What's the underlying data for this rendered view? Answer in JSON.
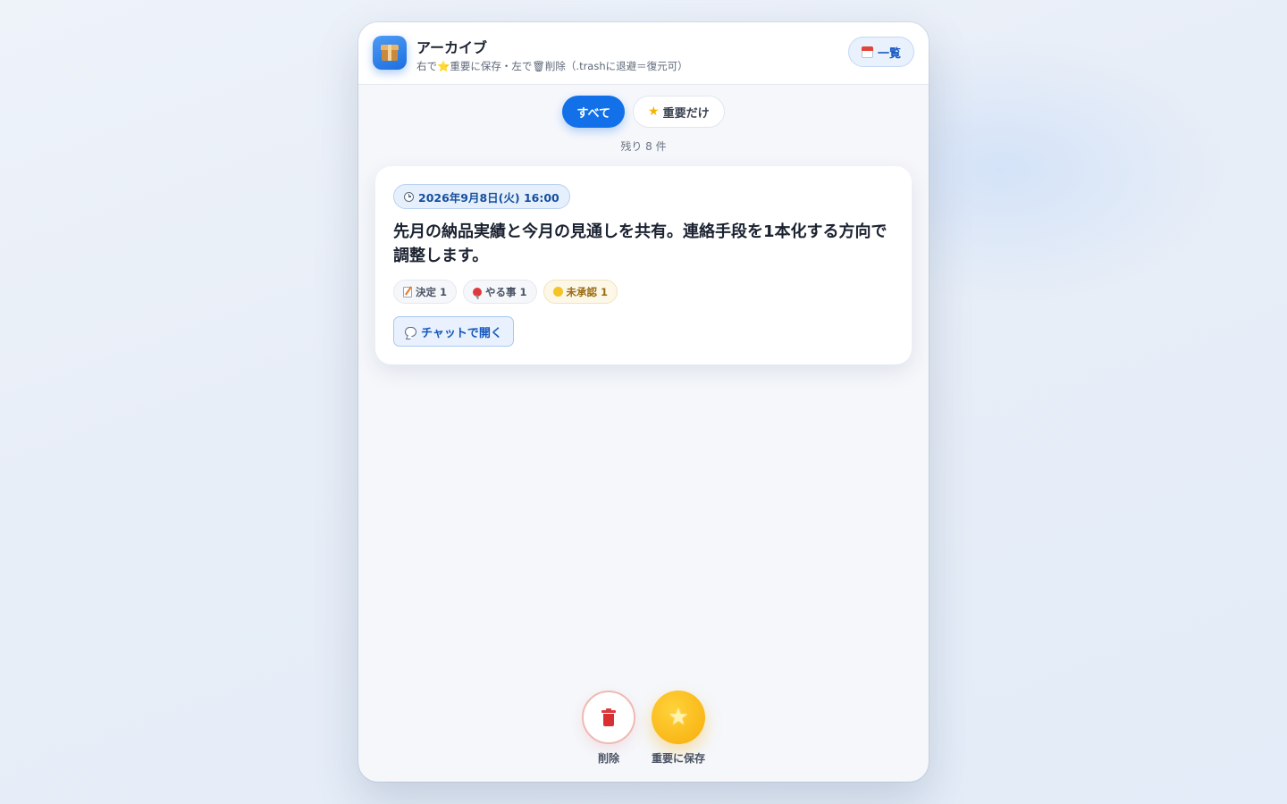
{
  "header": {
    "title": "アーカイブ",
    "subtitle": "右で⭐重要に保存・左で🗑削除（.trashに退避＝復元可）",
    "app_icon": "package-icon",
    "list_button_label": "一覧",
    "list_button_icon": "calendar-icon"
  },
  "filters": {
    "all_label": "すべて",
    "important_label": "重要だけ",
    "important_icon": "star-icon",
    "active": "all"
  },
  "remaining": "残り 8 件",
  "card": {
    "date": "2026年9月8日(火) 16:00",
    "date_icon": "clock-icon",
    "summary": "先月の納品実績と今月の見通しを共有。連絡手段を1本化する方向で調整します。",
    "tags": [
      {
        "icon": "memo-icon",
        "label": "決定 1"
      },
      {
        "icon": "pushpin-icon",
        "label": "やる事 1"
      },
      {
        "icon": "yellow-circle-icon",
        "label": "未承認 1"
      }
    ],
    "chat_button_label": "チャットで開く",
    "chat_button_icon": "speech-bubble-icon"
  },
  "actions": {
    "delete_label": "削除",
    "delete_icon": "trash-icon",
    "save_label": "重要に保存",
    "save_icon": "star-icon"
  },
  "colors": {
    "accent": "#1271e8",
    "save": "#f7ad0a",
    "delete": "#d92f32"
  }
}
